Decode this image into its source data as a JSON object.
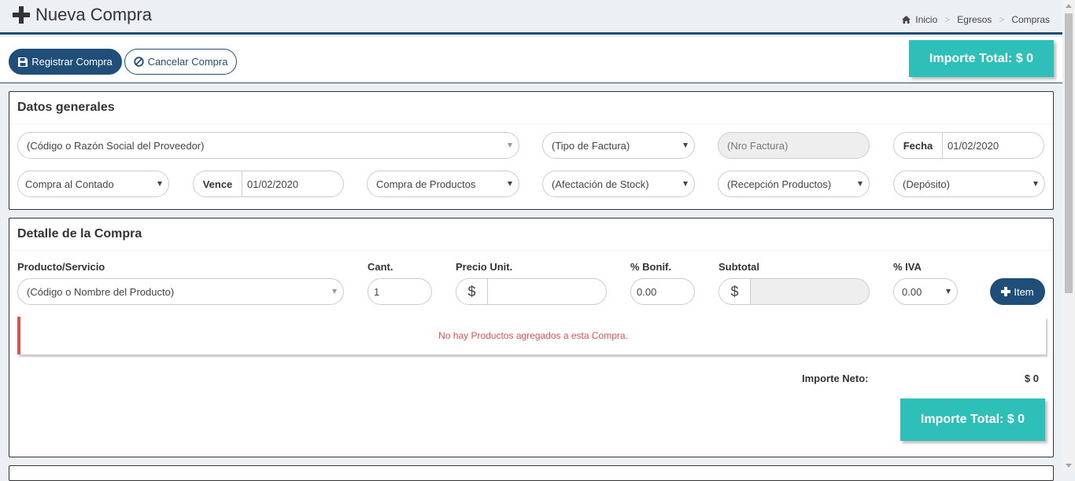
{
  "header": {
    "title": "Nueva Compra",
    "breadcrumb": [
      "Inicio",
      "Egresos",
      "Compras"
    ]
  },
  "toolbar": {
    "save_label": "Registrar Compra",
    "cancel_label": "Cancelar Compra",
    "total_label": "Importe Total: $ 0"
  },
  "general": {
    "title": "Datos generales",
    "proveedor": "(Código o Razón Social del Proveedor)",
    "tipo_factura": "(Tipo de Factura)",
    "nro_factura_placeholder": "(Nro Factura)",
    "fecha_label": "Fecha",
    "fecha_value": "01/02/2020",
    "condicion": "Compra al Contado",
    "vence_label": "Vence",
    "vence_value": "01/02/2020",
    "tipo_compra": "Compra de Productos",
    "afectacion": "(Afectación de Stock)",
    "recepcion": "(Recepción Productos)",
    "deposito": "(Depósito)"
  },
  "detalle": {
    "title": "Detalle de la Compra",
    "labels": {
      "producto": "Producto/Servicio",
      "cant": "Cant.",
      "precio": "Precio Unit.",
      "bonif": "% Bonif.",
      "subtotal": "Subtotal",
      "iva": "% IVA"
    },
    "producto_placeholder": "(Código o Nombre del Producto)",
    "cant_value": "1",
    "currency_symbol": "$",
    "precio_value": "",
    "bonif_value": "0.00",
    "subtotal_value": "",
    "iva_value": "0.00",
    "item_button": "Item",
    "empty_message": "No hay Productos agregados a esta Compra.",
    "neto_label": "Importe Neto:",
    "neto_value": "$ 0",
    "total_label": "Importe Total: $ 0"
  },
  "colors": {
    "primary": "#1f4e79",
    "total": "#2ebfb8",
    "danger": "#d9534f"
  }
}
